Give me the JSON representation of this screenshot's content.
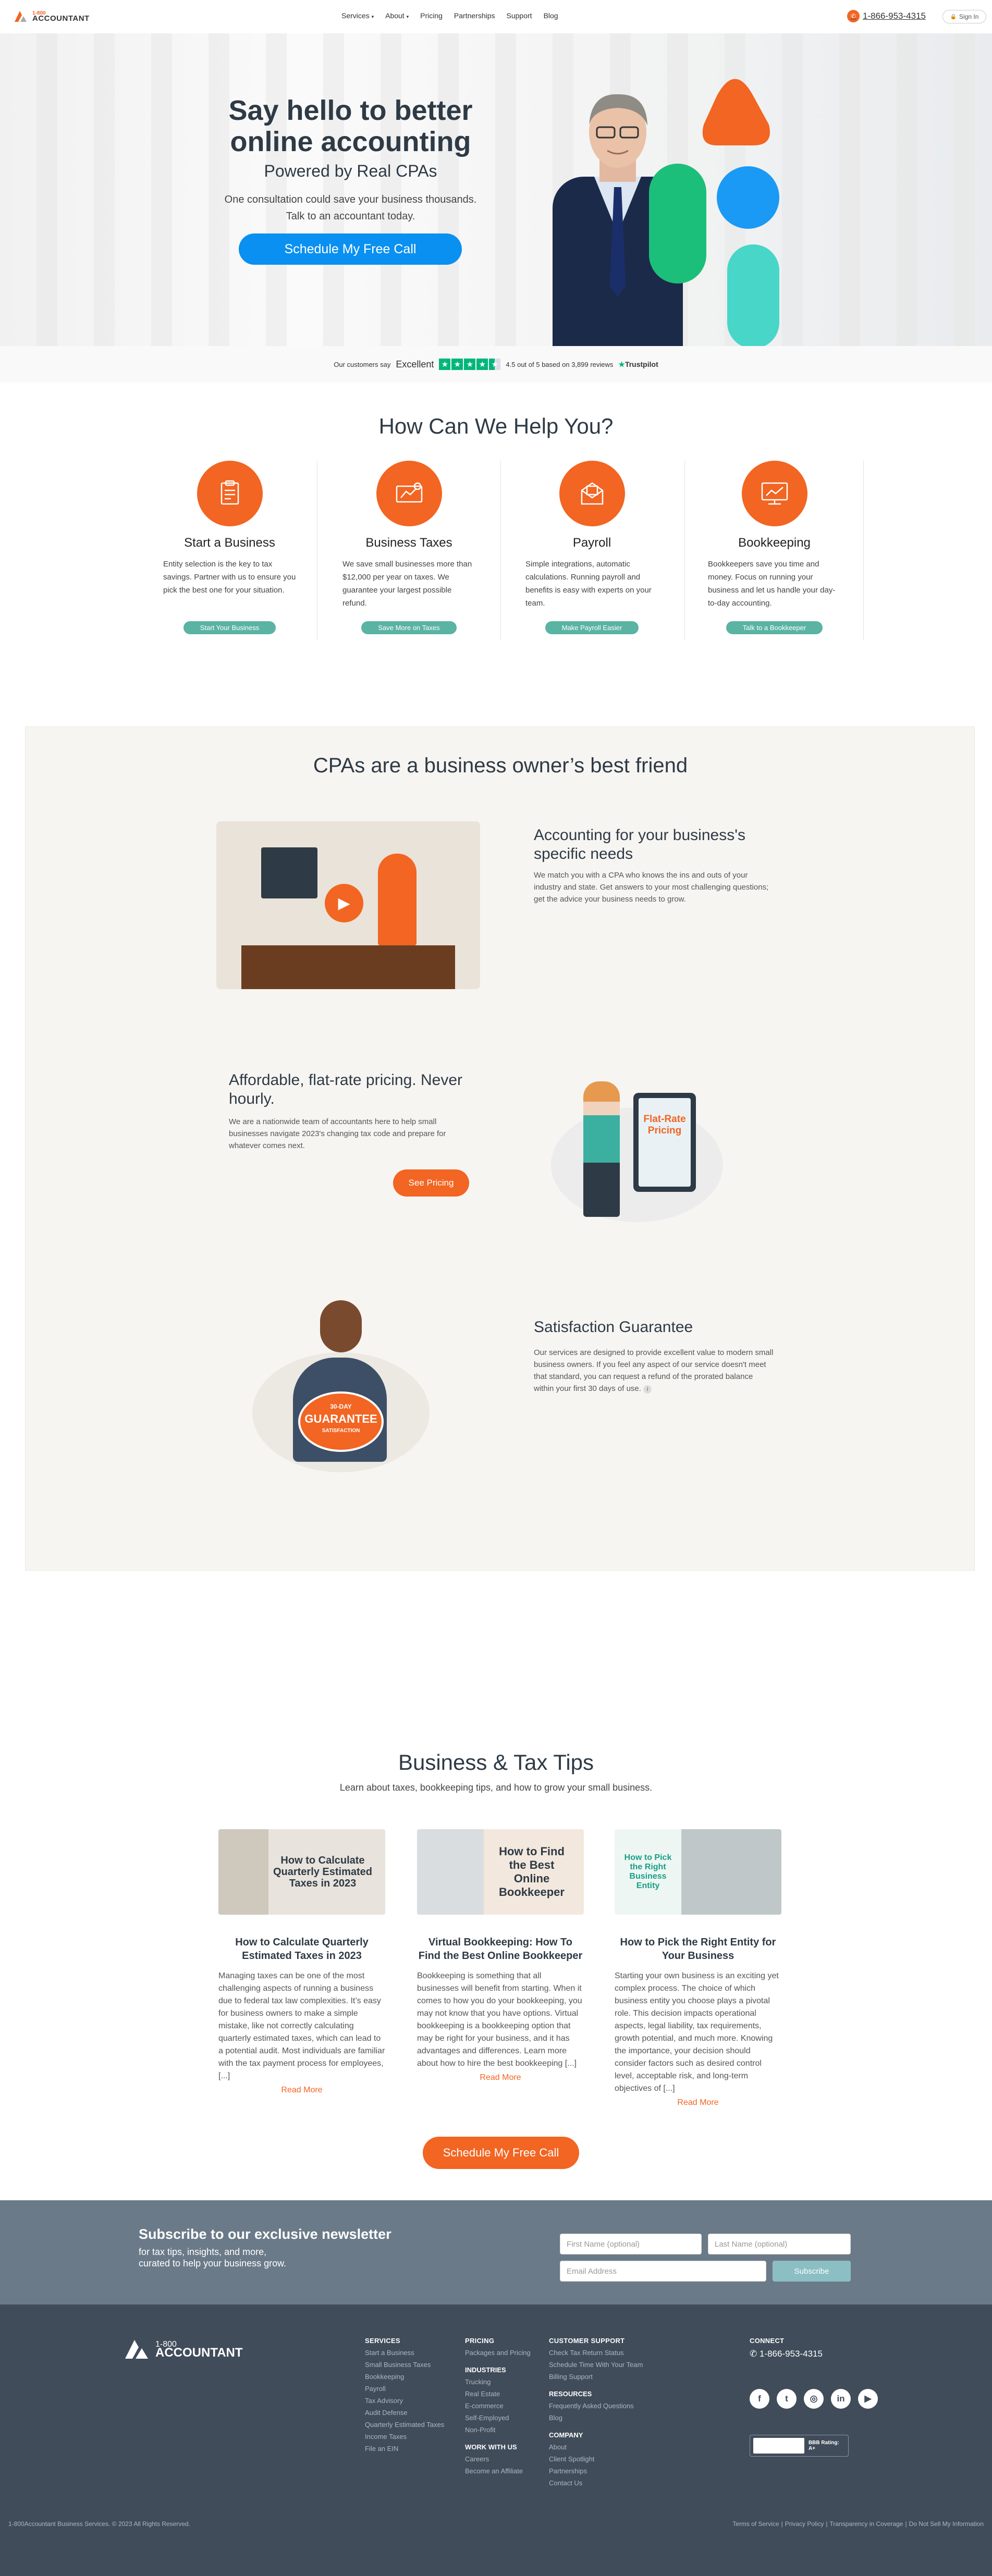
{
  "brand": {
    "number": "1-800",
    "name": "ACCOUNTANT",
    "accent": "#f26522",
    "blue": "#0a90f0",
    "teal": "#5ab3a3"
  },
  "nav": {
    "items": [
      "Services",
      "About",
      "Pricing",
      "Partnerships",
      "Support",
      "Blog"
    ],
    "phone": "1-866-953-4315",
    "signin": "Sign In"
  },
  "hero": {
    "title_line1": "Say hello to better",
    "title_line2": "online accounting",
    "subtitle": "Powered by Real CPAs",
    "body": "One consultation could save your business thousands. Talk to an accountant today.",
    "cta": "Schedule My Free Call"
  },
  "trustbar": {
    "prefix": "Our customers say",
    "rating_word": "Excellent",
    "score": "4.5 out of 5 based on 3,899 reviews",
    "brand": "Trustpilot",
    "stars": 4.5
  },
  "help": {
    "title": "How Can We Help You?",
    "cards": [
      {
        "title": "Start a Business",
        "body": "Entity selection is the key to tax savings. Partner with us to ensure you pick the best one for your situation.",
        "button": "Start Your Business",
        "icon": "document-icon"
      },
      {
        "title": "Business Taxes",
        "body": "We save small businesses more than $12,000 per year on taxes. We guarantee your largest possible refund.",
        "button": "Save More on Taxes",
        "icon": "tax-receipt-icon"
      },
      {
        "title": "Payroll",
        "body": "Simple integrations, automatic calculations. Running payroll and benefits is easy with experts on your team.",
        "button": "Make Payroll Easier",
        "icon": "payroll-envelope-icon"
      },
      {
        "title": "Bookkeeping",
        "body": "Bookkeepers save you time and money. Focus on running your business and let us handle your day-to-day accounting.",
        "button": "Talk to a Bookkeeper",
        "icon": "chart-screen-icon"
      }
    ]
  },
  "friend": {
    "title": "CPAs are a business owner’s best friend",
    "row1": {
      "title": "Accounting for your business's specific needs",
      "body": "We match you with a CPA who knows the ins and outs of your industry and state. Get answers to your most challenging questions; get the advice your business needs to grow."
    },
    "row2": {
      "title": "Affordable, flat-rate pricing. Never hourly.",
      "body": "We are a nationwide team of accountants here to help small businesses navigate 2023's changing tax code and prepare for whatever comes next.",
      "button": "See Pricing",
      "phone_line1": "Flat-Rate",
      "phone_line2": "Pricing"
    },
    "row3": {
      "title": "Satisfaction Guarantee",
      "body": "Our services are designed to provide excellent value to modern small business owners. If you feel any aspect of our service doesn't meet that standard, you can request a refund of the prorated balance within your first 30 days of use.",
      "info": "i",
      "badge": "GUARANTEE",
      "badge_top": "30-DAY",
      "badge_bottom": "SATISFACTION"
    }
  },
  "tips": {
    "title": "Business & Tax Tips",
    "subtitle": "Learn about taxes, bookkeeping tips, and how to grow your small business.",
    "read_more": "Read More",
    "cta": "Schedule My Free Call",
    "posts": [
      {
        "img_text": "How to Calculate Quarterly Estimated Taxes in 2023",
        "title": "How to Calculate Quarterly Estimated Taxes in 2023",
        "body": "Managing taxes can be one of the most challenging aspects of running a business due to federal tax law complexities. It’s easy for business owners to make a simple mistake, like not correctly calculating quarterly estimated taxes, which can lead to a potential audit. Most individuals are familiar with the tax payment process for employees, [...]"
      },
      {
        "img_text": "How to Find the Best Online Bookkeeper",
        "title": "Virtual Bookkeeping: How To Find the Best Online Bookkeeper",
        "body": "Bookkeeping is something that all businesses will benefit from starting. When it comes to how you do your bookkeeping, you may not know that you have options.  Virtual bookkeeping is a bookkeeping option that may be right for your business, and it has advantages and differences. Learn more about how to hire the best bookkeeping [...]"
      },
      {
        "img_text": "How to Pick the Right Business Entity",
        "title": "How to Pick the Right Entity for Your Business",
        "body": "Starting your own business is an exciting yet complex process. The choice of which business entity you choose plays a pivotal role. This decision impacts operational aspects, legal liability, tax requirements, growth potential, and much more. Knowing the importance, your decision should consider factors such as desired control level, acceptable risk, and long-term objectives of [...]"
      }
    ]
  },
  "newsletter": {
    "title": "Subscribe to our exclusive newsletter",
    "body_line1": "for tax tips, insights, and more,",
    "body_line2": "curated to help your business grow.",
    "first_ph": "First Name (optional)",
    "last_ph": "Last Name (optional)",
    "email_ph": "Email Address",
    "button": "Subscribe"
  },
  "footer": {
    "services": {
      "title": "SERVICES",
      "items": [
        "Start a Business",
        "Small Business Taxes",
        "Bookkeeping",
        "Payroll",
        "Tax Advisory",
        "Audit Defense",
        "Quarterly Estimated Taxes",
        "Income Taxes",
        "File an EIN"
      ]
    },
    "pricing": {
      "title": "PRICING",
      "items": [
        "Packages and Pricing"
      ]
    },
    "industries": {
      "title": "INDUSTRIES",
      "items": [
        "Trucking",
        "Real Estate",
        "E-commerce",
        "Self-Employed",
        "Non-Profit"
      ]
    },
    "work": {
      "title": "WORK WITH US",
      "items": [
        "Careers",
        "Become an Affiliate"
      ]
    },
    "support": {
      "title": "CUSTOMER SUPPORT",
      "items": [
        "Check Tax Return Status",
        "Schedule Time With Your Team",
        "Billing Support"
      ]
    },
    "resources": {
      "title": "RESOURCES",
      "items": [
        "Frequently Asked Questions",
        "Blog"
      ]
    },
    "company": {
      "title": "COMPANY",
      "items": [
        "About",
        "Client Spotlight",
        "Partnerships",
        "Contact Us"
      ]
    },
    "connect": {
      "title": "CONNECT",
      "phone": "1-866-953-4315",
      "social": [
        "facebook-icon",
        "twitter-icon",
        "instagram-icon",
        "linkedin-icon",
        "youtube-icon"
      ],
      "bbb": "BBB Rating: A+"
    },
    "copyright": "1-800Accountant Business Services. © 2023 All Rights Reserved.",
    "legal": [
      "Terms of Service",
      "Privacy Policy",
      "Transparency in Coverage",
      "Do Not Sell My Information"
    ]
  }
}
